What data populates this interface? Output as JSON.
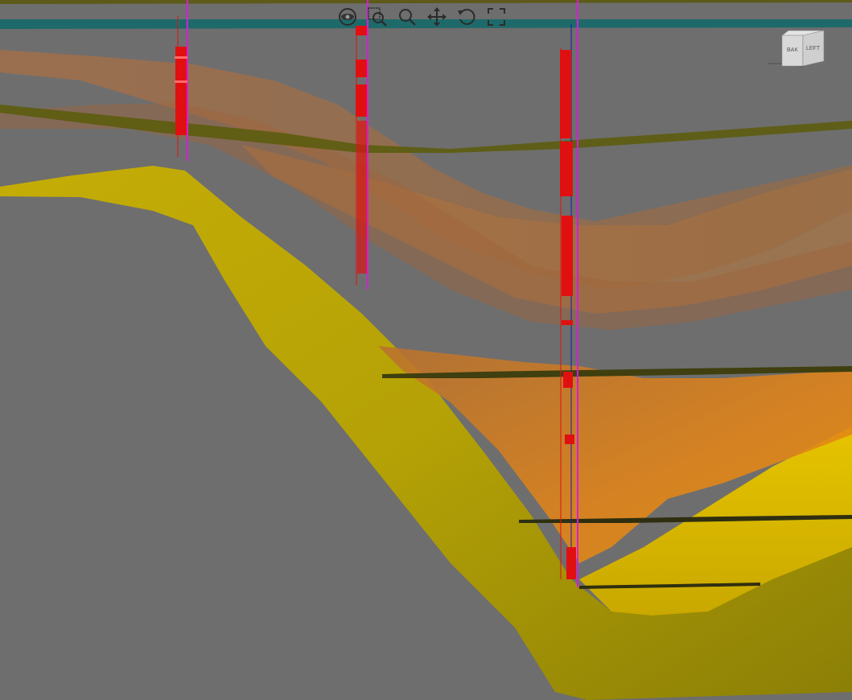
{
  "viewer": {
    "background_color": "#6e6e6e"
  },
  "toolbar": {
    "tools": [
      {
        "name": "orbit-icon",
        "icon": "eye"
      },
      {
        "name": "zoom-window-icon",
        "icon": "zoom-window"
      },
      {
        "name": "zoom-icon",
        "icon": "magnifier"
      },
      {
        "name": "pan-icon",
        "icon": "four-arrows"
      },
      {
        "name": "rotate-icon",
        "icon": "circular-arrow"
      },
      {
        "name": "fit-all-icon",
        "icon": "expand-arrows"
      }
    ]
  },
  "navcube": {
    "face_left": "LEFT",
    "face_front": "BAK"
  },
  "colors": {
    "horizon_top": "#1e6a6a",
    "surface_brown": "#a8682e",
    "surface_orange": "#d97c18",
    "surface_yellow": "#d9b400",
    "surface_olive": "#6b6a10",
    "well_red": "#e11010",
    "well_magenta": "#d61fd6"
  }
}
